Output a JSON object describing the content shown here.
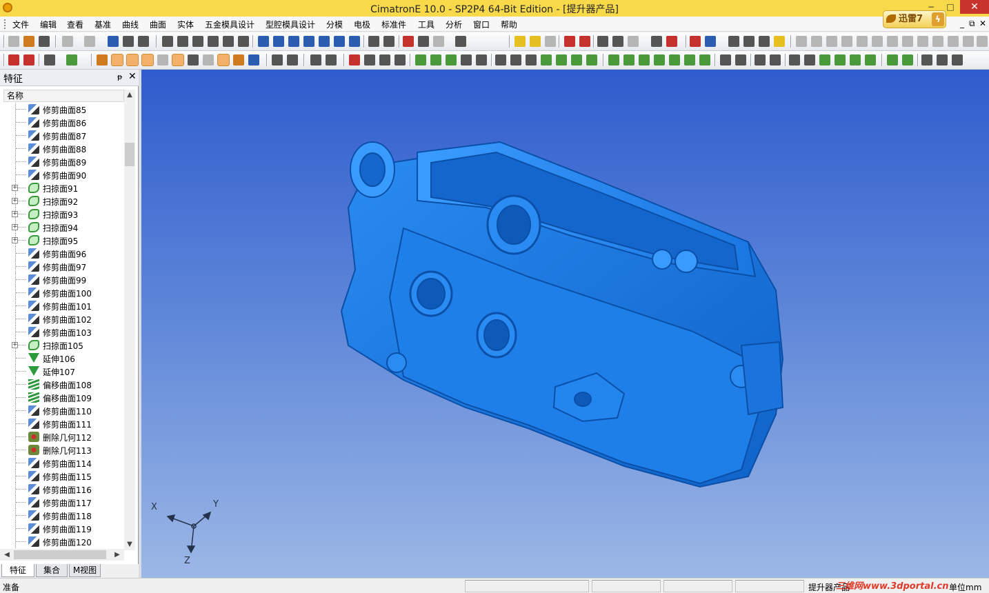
{
  "window": {
    "title": "CimatronE 10.0 - SP2P4 64-Bit Edition - [提升器产品]",
    "minimize": "−",
    "maximize": "□",
    "close": "✕"
  },
  "menu": {
    "items": [
      "文件",
      "编辑",
      "查看",
      "基准",
      "曲线",
      "曲面",
      "实体",
      "五金模具设计",
      "型腔模具设计",
      "分模",
      "电极",
      "标准件",
      "工具",
      "分析",
      "窗口",
      "帮助"
    ],
    "mdi_min": "_",
    "mdi_restore": "⧉",
    "mdi_close": "✕"
  },
  "xunlei_badge": {
    "label": "迅雷7",
    "bolt": "ϟ"
  },
  "panel": {
    "title": "特征",
    "pin": "ᵽ",
    "close": "✕",
    "column_header": "名称",
    "tree_items": [
      {
        "label": "修剪曲面85",
        "icon": "trim-surface-icon",
        "expandable": false
      },
      {
        "label": "修剪曲面86",
        "icon": "trim-surface-icon",
        "expandable": false
      },
      {
        "label": "修剪曲面87",
        "icon": "trim-surface-icon",
        "expandable": false
      },
      {
        "label": "修剪曲面88",
        "icon": "trim-surface-icon",
        "expandable": false
      },
      {
        "label": "修剪曲面89",
        "icon": "trim-surface-icon",
        "expandable": false
      },
      {
        "label": "修剪曲面90",
        "icon": "trim-surface-icon",
        "expandable": false
      },
      {
        "label": "扫掠面91",
        "icon": "sweep-surface-icon",
        "expandable": true
      },
      {
        "label": "扫掠面92",
        "icon": "sweep-surface-icon",
        "expandable": true
      },
      {
        "label": "扫掠面93",
        "icon": "sweep-surface-icon",
        "expandable": true
      },
      {
        "label": "扫掠面94",
        "icon": "sweep-surface-icon",
        "expandable": true
      },
      {
        "label": "扫掠面95",
        "icon": "sweep-surface-icon",
        "expandable": true
      },
      {
        "label": "修剪曲面96",
        "icon": "trim-surface-icon",
        "expandable": false
      },
      {
        "label": "修剪曲面97",
        "icon": "trim-surface-icon",
        "expandable": false
      },
      {
        "label": "修剪曲面99",
        "icon": "trim-surface-icon",
        "expandable": false
      },
      {
        "label": "修剪曲面100",
        "icon": "trim-surface-icon",
        "expandable": false
      },
      {
        "label": "修剪曲面101",
        "icon": "trim-surface-icon",
        "expandable": false
      },
      {
        "label": "修剪曲面102",
        "icon": "trim-surface-icon",
        "expandable": false
      },
      {
        "label": "修剪曲面103",
        "icon": "trim-surface-icon",
        "expandable": false
      },
      {
        "label": "扫掠面105",
        "icon": "sweep-surface-icon",
        "expandable": true
      },
      {
        "label": "延伸106",
        "icon": "extend-icon",
        "expandable": false
      },
      {
        "label": "延伸107",
        "icon": "extend-icon",
        "expandable": false
      },
      {
        "label": "偏移曲面108",
        "icon": "offset-surface-icon",
        "expandable": false
      },
      {
        "label": "偏移曲面109",
        "icon": "offset-surface-icon",
        "expandable": false
      },
      {
        "label": "修剪曲面110",
        "icon": "trim-surface-icon",
        "expandable": false
      },
      {
        "label": "修剪曲面111",
        "icon": "trim-surface-icon",
        "expandable": false
      },
      {
        "label": "删除几何112",
        "icon": "delete-geometry-icon",
        "expandable": false
      },
      {
        "label": "删除几何113",
        "icon": "delete-geometry-icon",
        "expandable": false
      },
      {
        "label": "修剪曲面114",
        "icon": "trim-surface-icon",
        "expandable": false
      },
      {
        "label": "修剪曲面115",
        "icon": "trim-surface-icon",
        "expandable": false
      },
      {
        "label": "修剪曲面116",
        "icon": "trim-surface-icon",
        "expandable": false
      },
      {
        "label": "修剪曲面117",
        "icon": "trim-surface-icon",
        "expandable": false
      },
      {
        "label": "修剪曲面118",
        "icon": "trim-surface-icon",
        "expandable": false
      },
      {
        "label": "修剪曲面119",
        "icon": "trim-surface-icon",
        "expandable": false
      },
      {
        "label": "修剪曲面120",
        "icon": "trim-surface-icon",
        "expandable": false
      }
    ],
    "tabs": [
      "特征",
      "集合",
      "M视图"
    ],
    "active_tab": "特征"
  },
  "viewport": {
    "axis_labels": {
      "x": "X",
      "y": "Y",
      "z": "Z"
    },
    "model_color": "#1a78e0"
  },
  "status": {
    "text": "准备",
    "document_name": "提升器产品",
    "unit": "单位mm"
  },
  "watermark": "三维网www.3dportal.cn"
}
